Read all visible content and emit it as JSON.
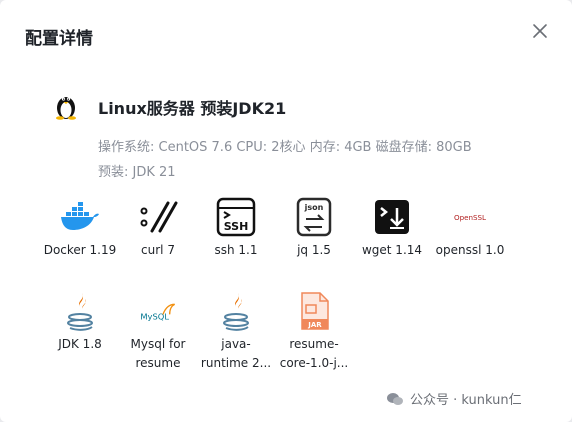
{
  "dialog": {
    "title": "配置详情",
    "server": {
      "name": "Linux服务器 预装JDK21",
      "specs": "操作系统: CentOS 7.6 CPU: 2核心 内存: 4GB 磁盘存储: 80GB",
      "preinstalled": "预装: JDK 21"
    },
    "apps": [
      {
        "icon": "docker-icon",
        "label": "Docker 1.19"
      },
      {
        "icon": "curl-icon",
        "label": "curl 7"
      },
      {
        "icon": "ssh-icon",
        "label": "ssh 1.1",
        "icon_text": "SSH"
      },
      {
        "icon": "jq-icon",
        "label": "jq 1.5",
        "icon_text": "json"
      },
      {
        "icon": "wget-icon",
        "label": "wget 1.14"
      },
      {
        "icon": "openssl-icon",
        "label": "openssl 1.0",
        "icon_text": "OpenSSL"
      },
      {
        "icon": "java-icon",
        "label": "JDK 1.8"
      },
      {
        "icon": "mysql-icon",
        "label": "Mysql for resume",
        "icon_text": "MySQL"
      },
      {
        "icon": "java-icon",
        "label": "java-runtime 2..."
      },
      {
        "icon": "jar-file-icon",
        "label": "resume-core-1.0-j...",
        "icon_text": "JAR"
      }
    ]
  },
  "watermark": {
    "text": "公众号 · kunkun仁"
  },
  "colors": {
    "docker": "#2496ed",
    "java_red": "#e76f00",
    "java_blue": "#5382a1",
    "openssl_red": "#b22222",
    "jar_orange": "#f0885a"
  }
}
